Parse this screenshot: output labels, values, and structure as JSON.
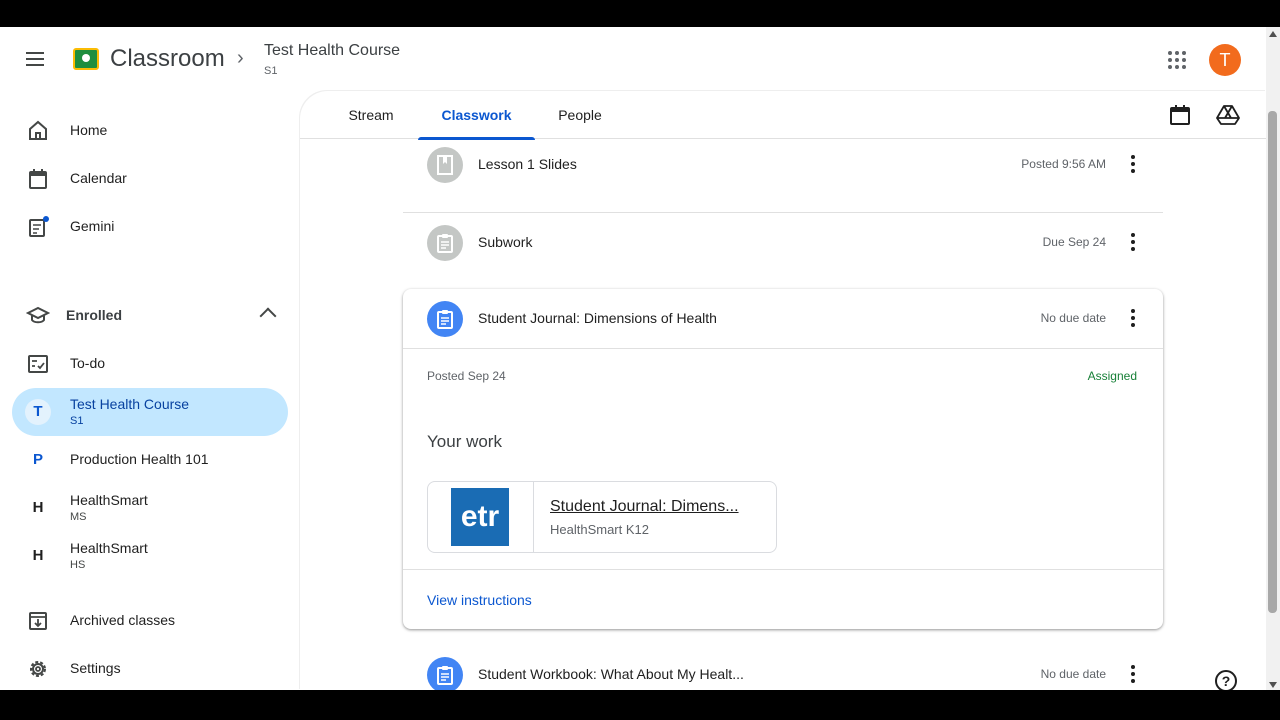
{
  "header": {
    "brand": "Classroom",
    "course_title": "Test Health Course",
    "course_section": "S1",
    "avatar_letter": "T"
  },
  "sidebar": {
    "items": [
      {
        "label": "Home",
        "icon": "home-icon"
      },
      {
        "label": "Calendar",
        "icon": "calendar-icon"
      },
      {
        "label": "Gemini",
        "icon": "gemini-icon"
      }
    ],
    "enrolled_label": "Enrolled",
    "todo_label": "To-do",
    "classes": [
      {
        "letter": "T",
        "name": "Test Health Course",
        "section": "S1"
      },
      {
        "letter": "P",
        "name": "Production Health 101",
        "section": ""
      },
      {
        "letter": "H",
        "name": "HealthSmart",
        "section": "MS"
      },
      {
        "letter": "H",
        "name": "HealthSmart",
        "section": "HS"
      }
    ],
    "archived_label": "Archived classes",
    "settings_label": "Settings"
  },
  "tabs": [
    {
      "label": "Stream"
    },
    {
      "label": "Classwork"
    },
    {
      "label": "People"
    }
  ],
  "classwork": {
    "items": [
      {
        "title": "Lesson 1 Slides",
        "meta": "Posted 9:56 AM",
        "icon": "material-icon"
      },
      {
        "title": "Subwork",
        "meta": "Due Sep 24",
        "icon": "assignment-icon"
      }
    ],
    "expanded": {
      "title": "Student Journal: Dimensions of Health",
      "meta": "No due date",
      "posted": "Posted Sep 24",
      "status": "Assigned",
      "your_work_label": "Your work",
      "attachment_logo": "etr",
      "attachment_title": "Student Journal: Dimens...",
      "attachment_source": "HealthSmart K12",
      "view_instructions": "View instructions"
    },
    "last_item": {
      "title": "Student Workbook: What About My Healt...",
      "meta": "No due date"
    }
  },
  "colors": {
    "accent": "#0b57d0",
    "active_class_bg": "#c2e7ff",
    "assigned_green": "#188038",
    "avatar_orange": "#f26b1d"
  }
}
